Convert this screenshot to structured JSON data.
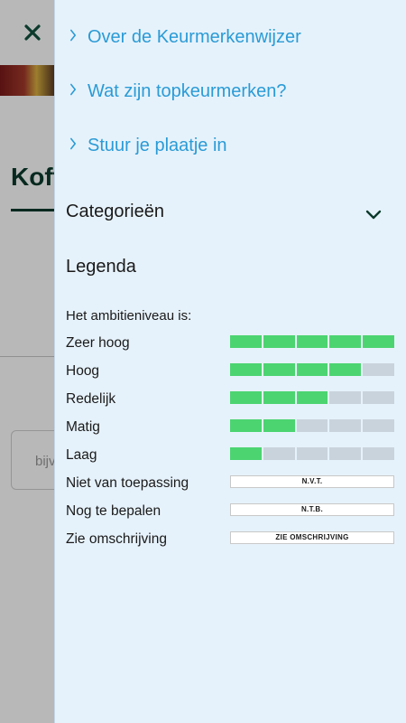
{
  "background_page": {
    "title": "Koff",
    "search_placeholder": "bijv"
  },
  "drawer": {
    "links": [
      {
        "label": "Over de Keurmerkenwijzer"
      },
      {
        "label": "Wat zijn topkeurmerken?"
      },
      {
        "label": "Stuur je plaatje in"
      }
    ],
    "categories_label": "Categorieën",
    "legend_label": "Legenda",
    "ambition_label": "Het ambitieniveau is:",
    "levels": [
      {
        "label": "Zeer hoog",
        "filled": 5,
        "of": 5
      },
      {
        "label": "Hoog",
        "filled": 4,
        "of": 5
      },
      {
        "label": "Redelijk",
        "filled": 3,
        "of": 5
      },
      {
        "label": "Matig",
        "filled": 2,
        "of": 5
      },
      {
        "label": "Laag",
        "filled": 1,
        "of": 5
      }
    ],
    "tags": [
      {
        "label": "Niet van toepassing",
        "tag": "N.V.T."
      },
      {
        "label": "Nog te bepalen",
        "tag": "N.T.B."
      },
      {
        "label": "Zie omschrijving",
        "tag": "ZIE OMSCHRIJVING"
      }
    ]
  },
  "colors": {
    "link": "#2a9bd6",
    "bar_on": "#4cd471",
    "bar_off": "#c9d3dc",
    "drawer_bg": "#e6f2fb",
    "dark_green": "#0b3a2c"
  },
  "icons": {
    "close": "close-icon",
    "link_chevron": "chevron-right-icon",
    "categories_chevron": "chevron-down-icon"
  }
}
